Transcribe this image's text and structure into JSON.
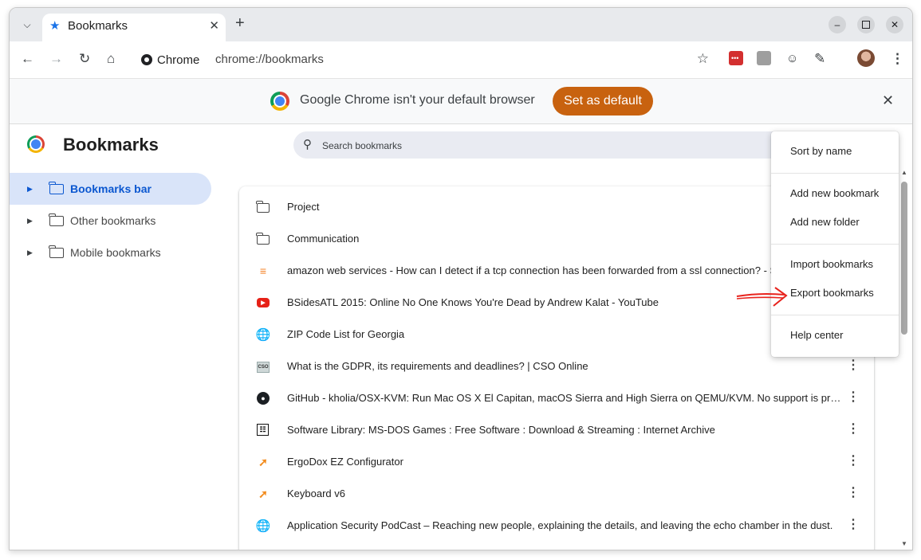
{
  "tabstrip": {
    "tab_title": "Bookmarks",
    "tab_icon": "star-icon",
    "close_glyph": "✕",
    "new_tab_glyph": "+"
  },
  "toolbar": {
    "chip_label": "Chrome",
    "url": "chrome://bookmarks"
  },
  "infobar": {
    "message": "Google Chrome isn't your default browser",
    "button_label": "Set as default"
  },
  "page": {
    "title": "Bookmarks",
    "search_placeholder": "Search bookmarks"
  },
  "sidebar": {
    "items": [
      {
        "label": "Bookmarks bar",
        "selected": true
      },
      {
        "label": "Other bookmarks",
        "selected": false
      },
      {
        "label": "Mobile bookmarks",
        "selected": false
      }
    ]
  },
  "bookmarks": [
    {
      "title": "Project",
      "icon": "folder-icon"
    },
    {
      "title": "Communication",
      "icon": "folder-icon"
    },
    {
      "title": "amazon web services - How can I detect if a tcp connection has been forwarded from a ssl connection? - S",
      "icon": "stackoverflow-icon"
    },
    {
      "title": "BSidesATL 2015: Online No One Knows You're Dead by Andrew Kalat - YouTube",
      "icon": "youtube-icon"
    },
    {
      "title": "ZIP Code List for Georgia",
      "icon": "globe-icon"
    },
    {
      "title": "What is the GDPR, its requirements and deadlines? | CSO Online",
      "icon": "cso-icon"
    },
    {
      "title": "GitHub - kholia/OSX-KVM: Run Mac OS X El Capitan, macOS Sierra and High Sierra on QEMU/KVM. No support is provi…",
      "icon": "github-icon"
    },
    {
      "title": "Software Library: MS-DOS Games : Free Software : Download & Streaming : Internet Archive",
      "icon": "archive-icon"
    },
    {
      "title": "ErgoDox EZ Configurator",
      "icon": "ergodox-icon"
    },
    {
      "title": "Keyboard v6",
      "icon": "ergodox-icon"
    },
    {
      "title": "Application Security PodCast – Reaching new people, explaining the details, and leaving the echo chamber in the dust.",
      "icon": "globe-icon"
    }
  ],
  "menu": {
    "sort_by_name": "Sort by name",
    "add_new_bookmark": "Add new bookmark",
    "add_new_folder": "Add new folder",
    "import_bookmarks": "Import bookmarks",
    "export_bookmarks": "Export bookmarks",
    "help_center": "Help center"
  },
  "colors": {
    "accent": "#0b57d0",
    "set_default_button": "#c8620f",
    "selected_sidebar_bg": "#d9e4f9",
    "annotation_arrow": "#e8231d"
  }
}
